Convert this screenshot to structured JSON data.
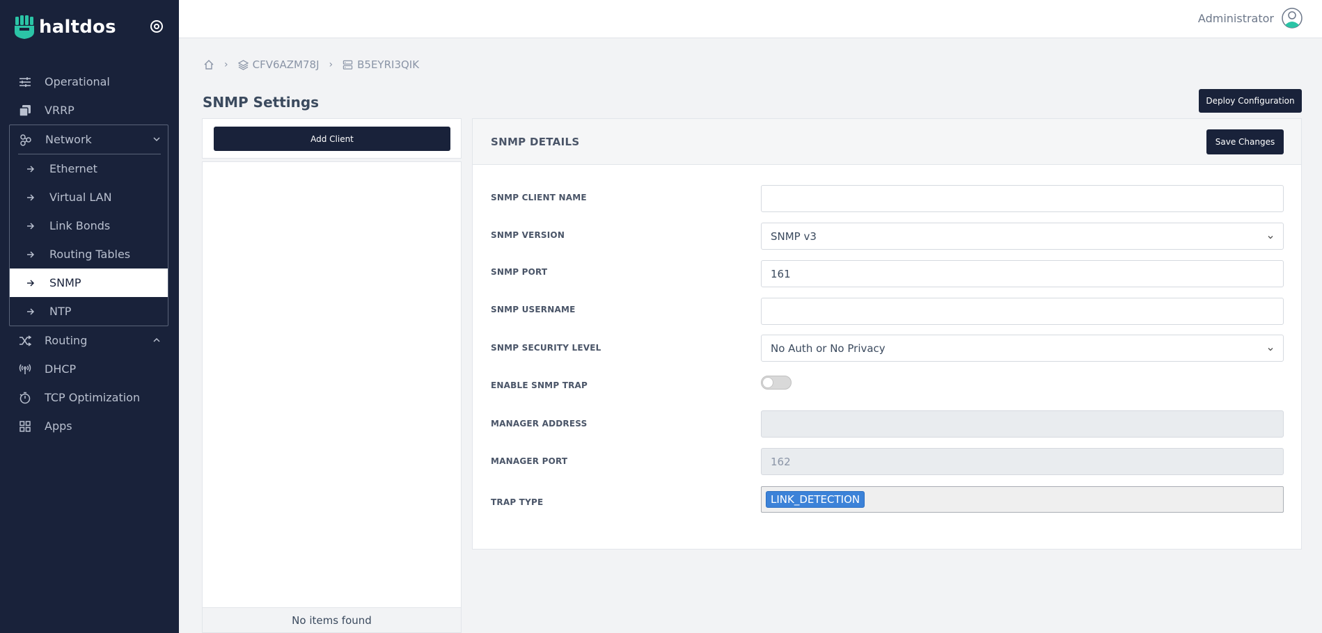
{
  "app": {
    "brand": "haltdos"
  },
  "topbar": {
    "user_name": "Administrator"
  },
  "breadcrumb": {
    "items": [
      "CFV6AZM78J",
      "B5EYRI3QIK"
    ],
    "separator": "›"
  },
  "page": {
    "title": "SNMP Settings",
    "deploy_label": "Deploy Configuration"
  },
  "sidebar": {
    "items_top": [
      {
        "label": "Operational",
        "icon": "sliders-icon"
      },
      {
        "label": "VRRP",
        "icon": "copy-icon"
      }
    ],
    "network": {
      "label": "Network",
      "icon": "network-icon",
      "children": [
        "Ethernet",
        "Virtual LAN",
        "Link Bonds",
        "Routing Tables",
        "SNMP",
        "NTP"
      ],
      "active": "SNMP"
    },
    "items_bottom": [
      {
        "label": "Routing",
        "icon": "shuffle-icon"
      },
      {
        "label": "DHCP",
        "icon": "broadcast-icon"
      },
      {
        "label": "TCP Optimization",
        "icon": "stopwatch-icon"
      },
      {
        "label": "Apps",
        "icon": "grid-icon"
      }
    ]
  },
  "left_panel": {
    "add_label": "Add Client",
    "empty_text": "No items found"
  },
  "details": {
    "title": "SNMP DETAILS",
    "save_label": "Save Changes",
    "fields": {
      "client_name": {
        "label": "SNMP CLIENT NAME",
        "value": ""
      },
      "version": {
        "label": "SNMP VERSION",
        "value": "SNMP v3"
      },
      "port": {
        "label": "SNMP PORT",
        "value": "161"
      },
      "username": {
        "label": "SNMP USERNAME",
        "value": ""
      },
      "security_level": {
        "label": "SNMP SECURITY LEVEL",
        "value": "No Auth or No Privacy"
      },
      "enable_trap": {
        "label": "ENABLE SNMP TRAP",
        "value": false
      },
      "manager_address": {
        "label": "MANAGER ADDRESS",
        "value": ""
      },
      "manager_port": {
        "label": "MANAGER PORT",
        "value": "162"
      },
      "trap_type": {
        "label": "TRAP TYPE",
        "tags": [
          "LINK_DETECTION"
        ]
      }
    }
  },
  "colors": {
    "sidebar_bg": "#19223a",
    "accent_dark": "#19223a",
    "tag_blue": "#3c82d8",
    "logo_teal": "#2bc4a6"
  }
}
